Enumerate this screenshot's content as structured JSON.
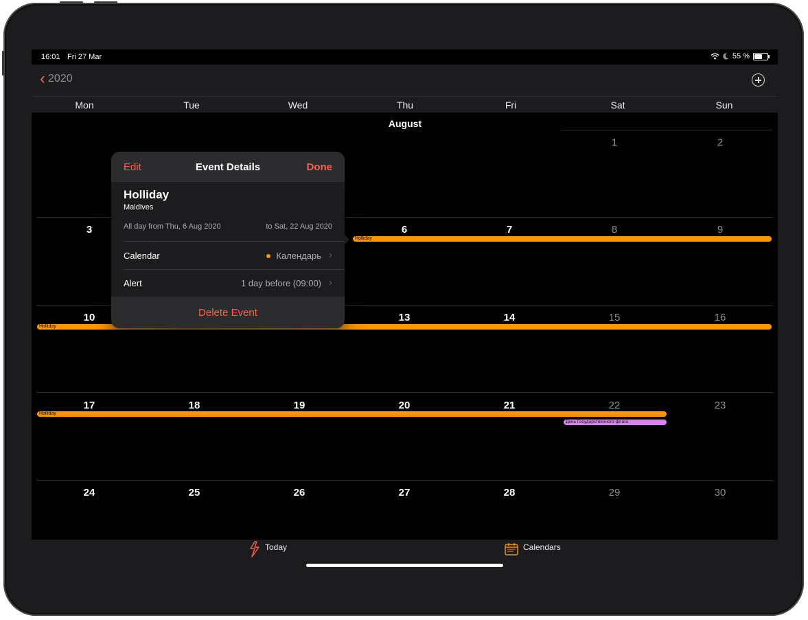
{
  "status": {
    "time": "16:01",
    "date": "Fri 27 Mar",
    "battery": "55 %"
  },
  "nav": {
    "back_label": "2020"
  },
  "weekdays": [
    "Mon",
    "Tue",
    "Wed",
    "Thu",
    "Fri",
    "Sat",
    "Sun"
  ],
  "month": "August",
  "days": {
    "d1": "1",
    "d2": "2",
    "d3": "3",
    "d6": "6",
    "d7": "7",
    "d8": "8",
    "d9": "9",
    "d10": "10",
    "d13": "13",
    "d14": "14",
    "d15": "15",
    "d16": "16",
    "d17": "17",
    "d18": "18",
    "d19": "19",
    "d20": "20",
    "d21": "21",
    "d22": "22",
    "d23": "23",
    "d24": "24",
    "d25": "25",
    "d26": "26",
    "d27": "27",
    "d28": "28",
    "d29": "29",
    "d30": "30"
  },
  "events": {
    "holiday": "Holliday",
    "flag_day": "День Государственного флага"
  },
  "colors": {
    "accent": "#ff5f46",
    "holiday_event": "#ff9500",
    "flag_event": "#d783ee"
  },
  "popover": {
    "edit_label": "Edit",
    "title": "Event Details",
    "done_label": "Done",
    "event_title": "Holliday",
    "event_location": "Maldives",
    "date_from": "All day from Thu, 6 Aug 2020",
    "date_to": "to Sat, 22 Aug 2020",
    "calendar_label": "Calendar",
    "calendar_value": "Календарь",
    "alert_label": "Alert",
    "alert_value": "1 day before (09:00)",
    "delete_label": "Delete Event"
  },
  "tabbar": {
    "today_label": "Today",
    "calendars_label": "Calendars"
  }
}
